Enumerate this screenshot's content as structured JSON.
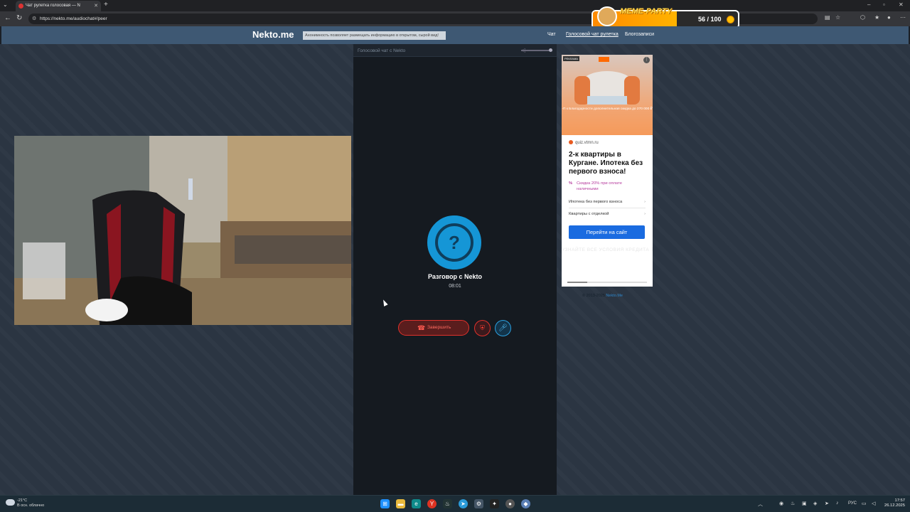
{
  "browser": {
    "tab_title": "Чат рулетка голосовая — N",
    "url": "https://nekto.me/audiochat#/peer"
  },
  "meme_widget": {
    "title": "MEME-PARTY",
    "score": "56 / 100"
  },
  "header": {
    "logo": "Nekto.me",
    "notice": "Анонимность позволяет размещать информацию в открытом, сырой вид!",
    "nav": [
      "Чат",
      "Голосовой чат рулетка",
      "Блогозаписи"
    ]
  },
  "chat": {
    "label": "Голосовой чат с Nekto",
    "call_title": "Разговор с Nekto",
    "call_time": "08:01",
    "end_button": "Завершить"
  },
  "ad": {
    "badge": "РЕКЛАМА",
    "image_caption": "-П к Благодарности дополнительная скидка до 270 000 ₽",
    "domain": "quiz.vtmn.ru",
    "headline": "2-к квартиры в Кургане. Ипотека без первого взноса!",
    "promo": "Скидка 20% при оплате наличными",
    "promo_mark": "%",
    "links": [
      "Ипотека без первого взноса",
      "Квартиры с отделкой"
    ],
    "cta": "Перейти на сайт",
    "watermark": "УЗНАЙТЕ ВСЕ УСЛОВИЯ КРЕДИТА ЗАЙМА НА САЙТЕ В СООТВЕТСТВУЮЩЕМ РАЗДЕЛЕ. ОЦЕНИВАЙТЕ СВОИ ФИНАНСОВЫЕ ВОЗМОЖНОСТИ И РИСКИ"
  },
  "footer": {
    "copyright": "© 2013-2025",
    "link": "Nekto.Me"
  },
  "taskbar": {
    "weather_temp": "-21°C",
    "weather_desc": "В осн. облачно",
    "lang": "РУС",
    "time": "17:57",
    "date": "26.12.2025"
  }
}
